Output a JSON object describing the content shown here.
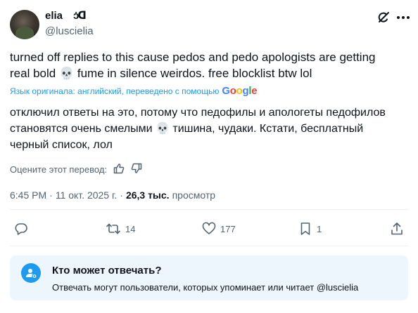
{
  "author": {
    "display_name": "elia",
    "name_emoji": "ɔ̇ᗡ",
    "handle": "@luscielia"
  },
  "tweet": {
    "text_line1": "turned off replies to this cause pedos and pedo apologists are getting",
    "text_line2a": "real bold",
    "skull": "💀",
    "text_line2b": "fume in silence weirdos. free blocklist btw lol"
  },
  "translation": {
    "meta": "Язык оригинала: английский, переведено с помощью",
    "brand": "Google",
    "text_line1": "отключил ответы на это, потому что педофилы и апологеты педофилов",
    "text_line2a": "становятся очень смелыми",
    "text_line2b": "тишина, чудаки. Кстати, бесплатный",
    "text_line3": "черный список, лол",
    "rate_label": "Оцените этот перевод:"
  },
  "meta": {
    "time": "6:45 PM",
    "separator": "·",
    "date": "11 окт. 2025 г.",
    "views_count": "26,3 тыс.",
    "views_label": "просмотр"
  },
  "actions": {
    "retweets": "14",
    "likes": "177",
    "bookmarks": "1"
  },
  "reply_settings": {
    "title": "Кто может отвечать?",
    "description": "Отвечать могут пользователи, которых упоминает или читает @luscielia"
  },
  "colors": {
    "accent": "#1d9bf0",
    "text_secondary": "#536471",
    "reply_box_bg": "#edf6fd"
  }
}
